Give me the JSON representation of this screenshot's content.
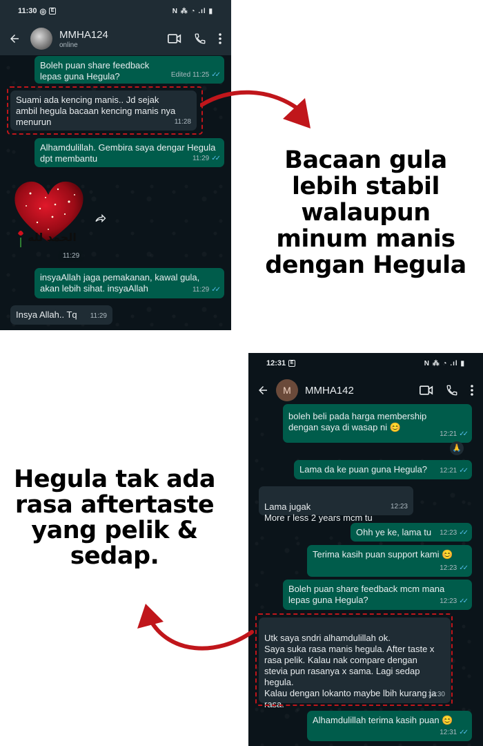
{
  "screen1": {
    "status": {
      "time": "11:30",
      "icons": "N ⁂ ◔ .ıl ▮"
    },
    "contact": {
      "name": "MMHA124",
      "status": "online"
    },
    "messages": [
      {
        "text": "Boleh puan share feedback lepas guna Hegula?",
        "meta": "Edited 11:25"
      },
      {
        "text": "Suami ada kencing manis.. Jd sejak ambil  hegula bacaan   kencing manis nya menurun",
        "time": "11:28"
      },
      {
        "text": "Alhamdulillah. Gembira saya dengar Hegula dpt membantu",
        "time": "11:29"
      },
      {
        "time": "11:29"
      },
      {
        "text": "insyaAllah jaga pemakanan, kawal gula, akan lebih sihat. insyaAllah",
        "time": "11:29"
      },
      {
        "text": "Insya Allah.. Tq",
        "time": "11:29"
      }
    ],
    "sticker_caption": "الحمد لله"
  },
  "headline1": "Bacaan gula lebih stabil walaupun minum manis dengan Hegula",
  "screen2": {
    "status": {
      "time": "12:31",
      "icons": "N ⁂ ◔ .ıl ▮"
    },
    "contact": {
      "name": "MMHA142",
      "initial": "M"
    },
    "messages": [
      {
        "text": "boleh beli pada harga membership dengan saya di wasap ni 😊",
        "time": "12:21"
      },
      {
        "text": "Lama da ke puan guna Hegula?",
        "time": "12:21"
      },
      {
        "text": "Lama jugak\nMore r less 2 years mcm tu",
        "time": "12:23"
      },
      {
        "text": "Ohh ye ke, lama tu",
        "time": "12:23"
      },
      {
        "text": "Terima kasih puan support kami 😊",
        "time": "12:23"
      },
      {
        "text": "Boleh puan share feedback mcm mana lepas guna Hegula?",
        "time": "12:23"
      },
      {
        "text": "Utk saya sndri alhamdulillah ok.\nSaya suka rasa manis hegula. After taste x rasa pelik. Kalau nak compare dengan stevia pun rasanya x sama. Lagi sedap hegula.\nKalau dengan lokanto maybe lbih kurang ja rasa.",
        "time": "12:30"
      },
      {
        "text": "Alhamdulillah terima kasih puan 😊",
        "time": "12:31"
      }
    ],
    "reaction": "🙏"
  },
  "headline2": "Hegula tak ada rasa aftertaste yang pelik & sedap.",
  "colors": {
    "accent_red": "#c0161b",
    "bubble_out": "#005c4b",
    "bubble_in": "#1f2c34",
    "chat_bg": "#0b141a",
    "tick_blue": "#53bdeb"
  }
}
